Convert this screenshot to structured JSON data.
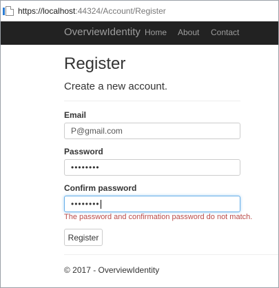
{
  "browser": {
    "url_host": "https://localhost",
    "url_rest": ":44324/Account/Register"
  },
  "navbar": {
    "brand": "OverviewIdentity",
    "links": [
      "Home",
      "About",
      "Contact"
    ]
  },
  "main": {
    "title": "Register",
    "subtitle": "Create a new account.",
    "email_label": "Email",
    "email_value": "P@gmail.com",
    "password_label": "Password",
    "password_value": "••••••••",
    "confirm_label": "Confirm password",
    "confirm_value": "••••••••",
    "error": "The password and confirmation password do not match.",
    "register_button": "Register"
  },
  "footer": {
    "text": "© 2017 - OverviewIdentity"
  },
  "colors": {
    "navbar_bg": "#222222",
    "error": "#b94a48",
    "focus_border": "#66afe9"
  }
}
